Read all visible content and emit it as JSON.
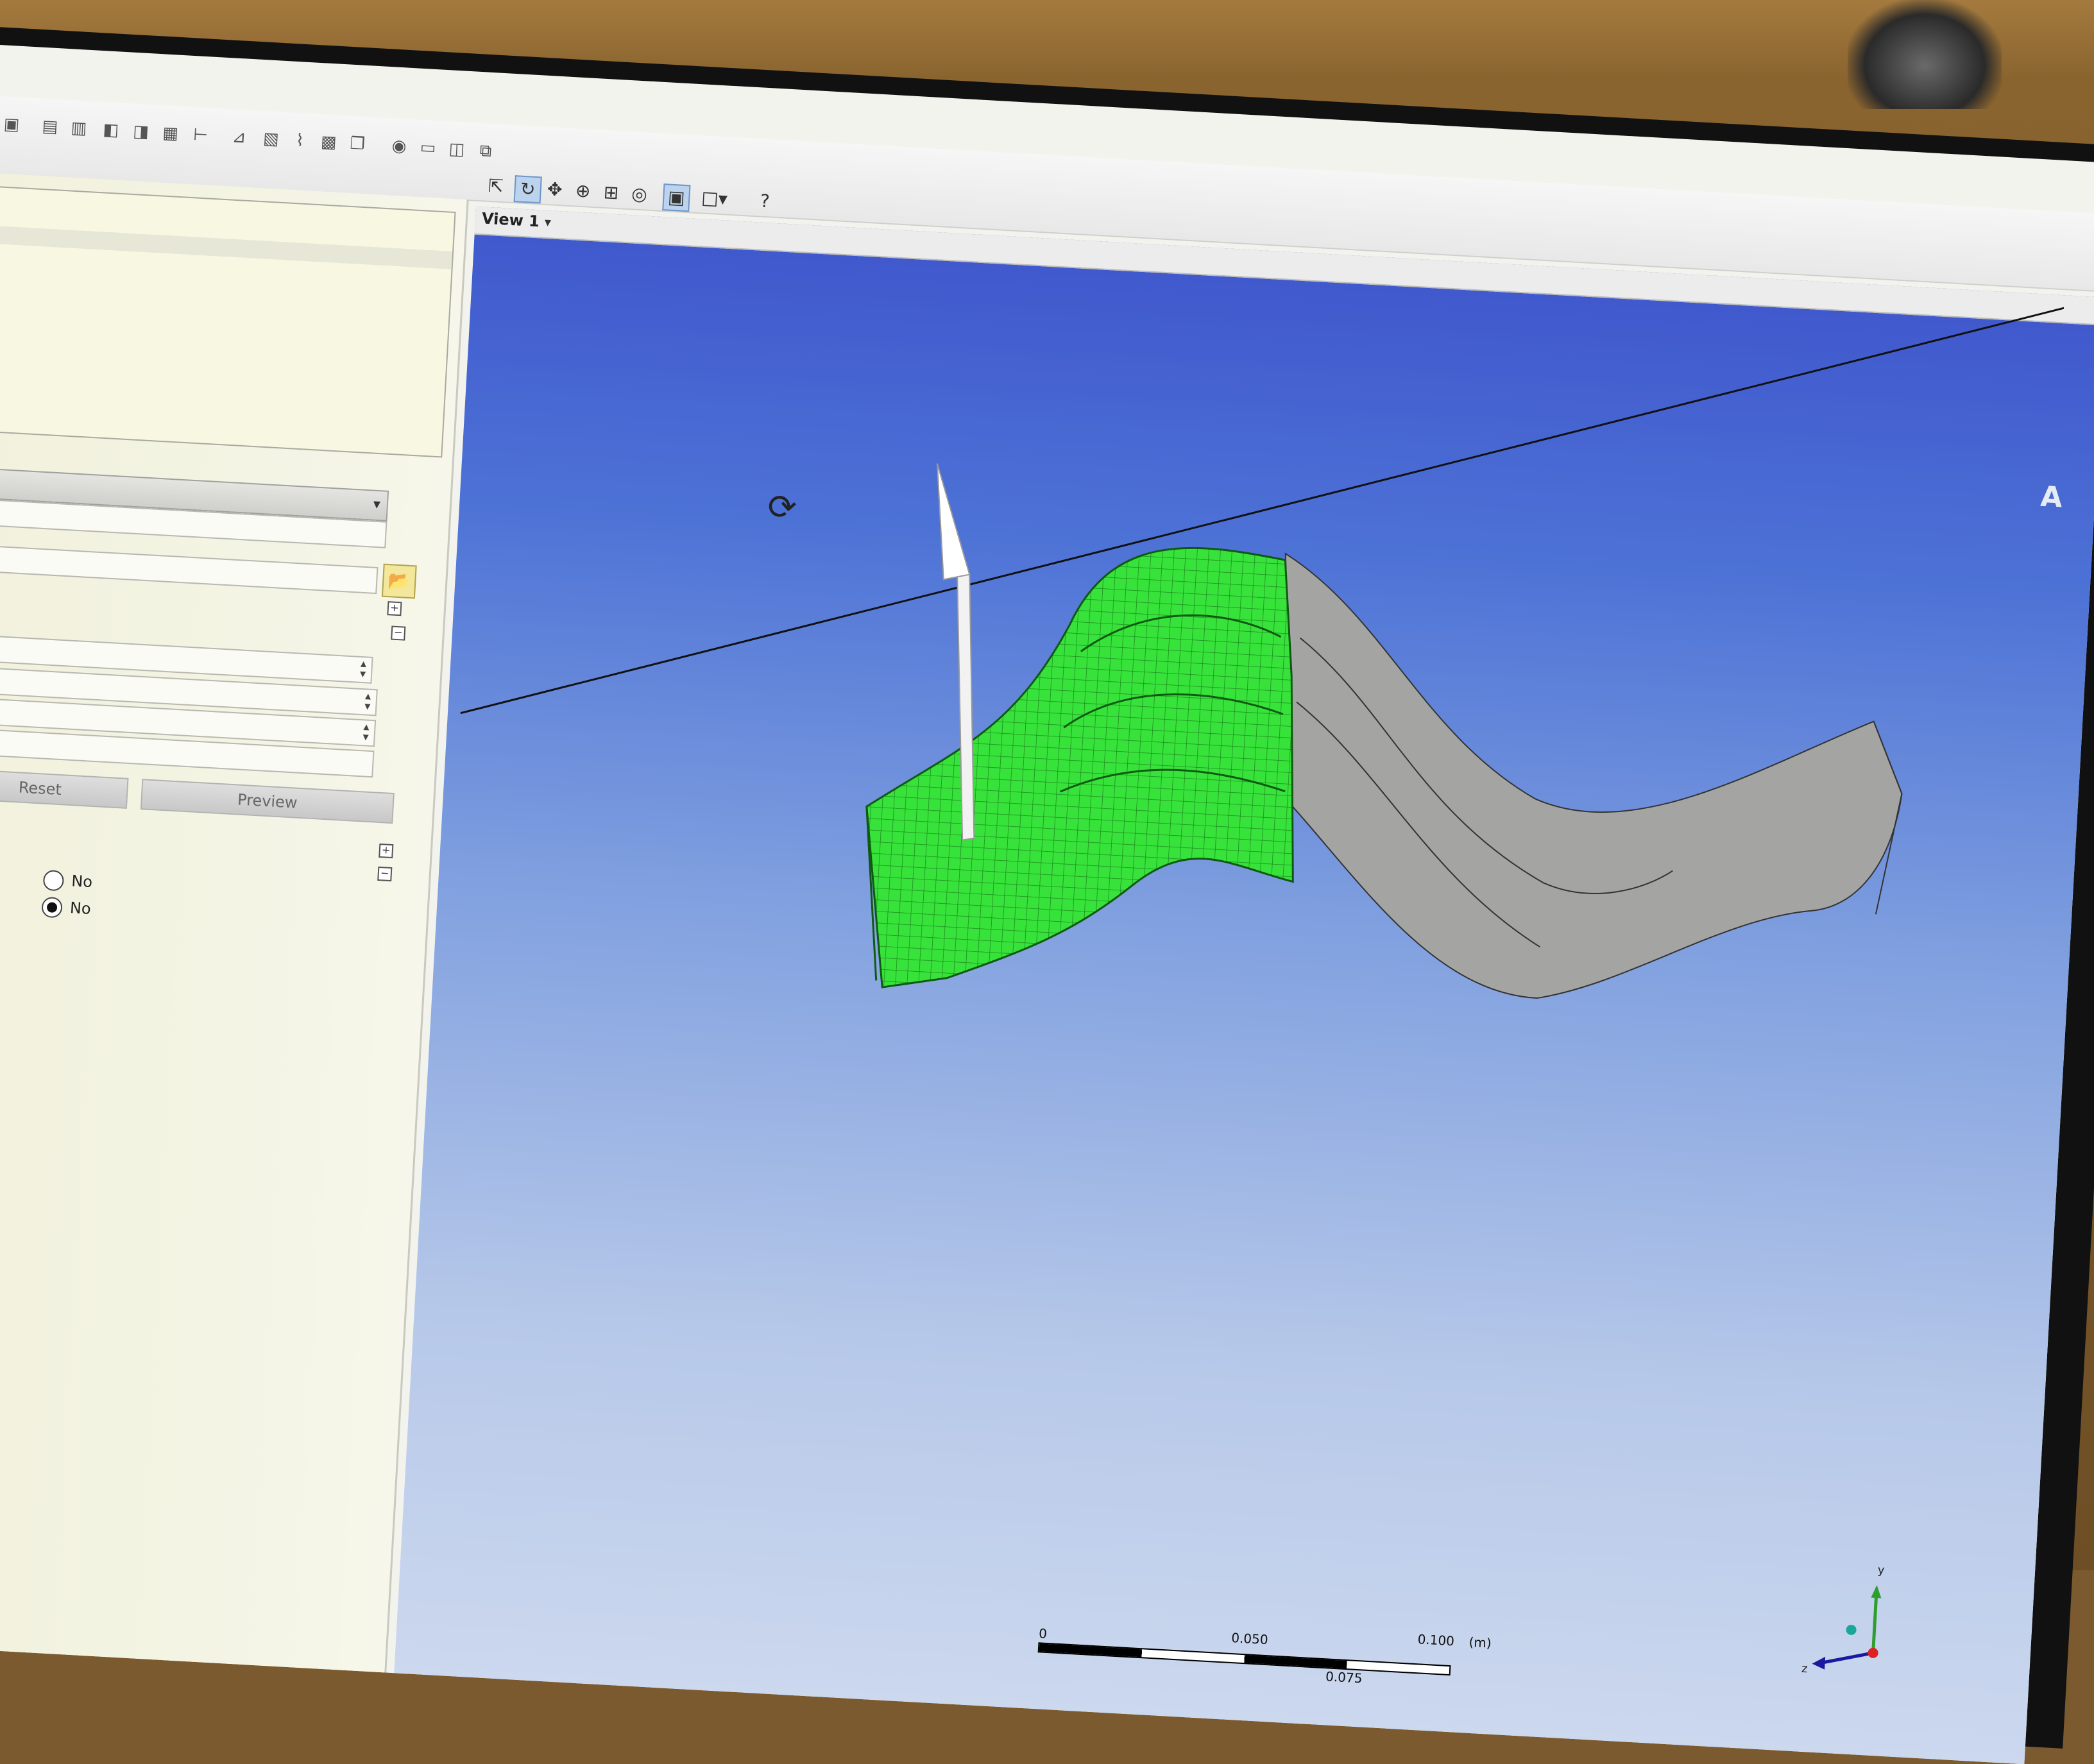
{
  "viewport": {
    "tab_label": "View 1",
    "brand_text": "A",
    "scale": {
      "ticks": [
        "0",
        "0.050",
        "0.100",
        "(m)",
        "0.075"
      ]
    },
    "triad": {
      "x_label": "",
      "y_label": "y",
      "z_label": "z"
    }
  },
  "left_panel": {
    "buttons": {
      "reset": "Reset",
      "preview": "Preview"
    },
    "radio_options": [
      {
        "label": "No",
        "checked": false
      },
      {
        "label": "No",
        "checked": true
      }
    ]
  },
  "icons": {
    "toolbar": [
      "box-icon",
      "solid-icon",
      "bar-icon",
      "cube-icon",
      "cube-alt-icon",
      "block-icon",
      "tree-icon",
      "draft-icon",
      "layer-icon",
      "pipe-icon",
      "grid-icon",
      "copy-icon",
      "camera-icon",
      "window-icon",
      "panel-icon",
      "split-icon"
    ],
    "view_toolbar": [
      "select-cursor-icon",
      "rotate-icon",
      "pan-icon",
      "zoom-icon",
      "zoom-box-icon",
      "zoom-fit-icon",
      "frame-icon",
      "display-style-icon",
      "help-icon"
    ]
  },
  "colors": {
    "mesh_green": "#37e23a",
    "body_gray": "#a4a5a2",
    "viewport_top": "#3f56cc",
    "viewport_bottom": "#ccd8ee"
  }
}
